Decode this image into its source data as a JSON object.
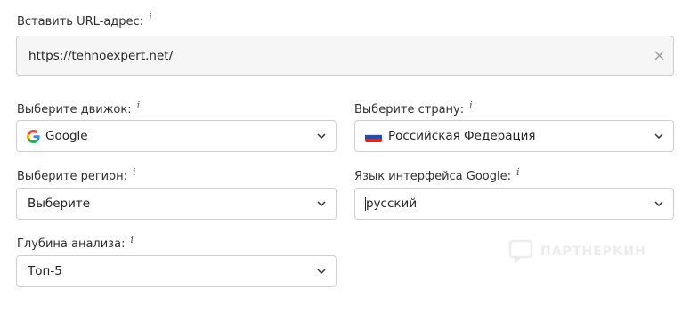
{
  "url_section": {
    "label": "Вставить URL-адрес:",
    "info": "i",
    "value": "https://tehnoexpert.net/"
  },
  "engine": {
    "label": "Выберите движок:",
    "info": "i",
    "value": "Google",
    "icon": "google-icon"
  },
  "country": {
    "label": "Выберите страну:",
    "info": "i",
    "value": "Российская Федерация",
    "icon": "russia-flag-icon"
  },
  "region": {
    "label": "Выберите регион:",
    "info": "i",
    "value": "Выберите"
  },
  "language": {
    "label": "Язык интерфейса Google:",
    "info": "i",
    "value": "русский"
  },
  "depth": {
    "label": "Глубина анализа:",
    "info": "i",
    "value": "Топ-5"
  },
  "watermark": {
    "text": "ПАРТНЕРКИН"
  },
  "colors": {
    "border": "#cfcfcf",
    "url_bg": "#f6f6f6",
    "text": "#222222",
    "flag_white": "#ffffff",
    "flag_blue": "#1f4fb3",
    "flag_red": "#d52b1e"
  }
}
